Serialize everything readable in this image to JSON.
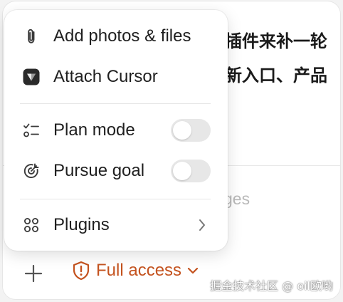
{
  "composer": {
    "background_text_line_1": "插件来补一轮",
    "background_text_line_2": "新入口、产品",
    "placeholder_fragment": "ges"
  },
  "toolbar": {
    "add_icon": "plus-icon",
    "access_label": "Full access",
    "access_icon": "shield-warning-icon",
    "access_color": "#c4531f"
  },
  "menu": {
    "items": [
      {
        "label": "Add photos & files",
        "icon": "paperclip-icon"
      },
      {
        "label": "Attach Cursor",
        "icon": "cursor-app-icon"
      },
      {
        "label": "Plan mode",
        "icon": "checklist-icon",
        "toggle": false
      },
      {
        "label": "Pursue goal",
        "icon": "goal-icon",
        "toggle": false
      },
      {
        "label": "Plugins",
        "icon": "plugins-grid-icon",
        "submenu": true
      }
    ]
  },
  "watermark": "掘金技术社区 @ oil欧哟"
}
